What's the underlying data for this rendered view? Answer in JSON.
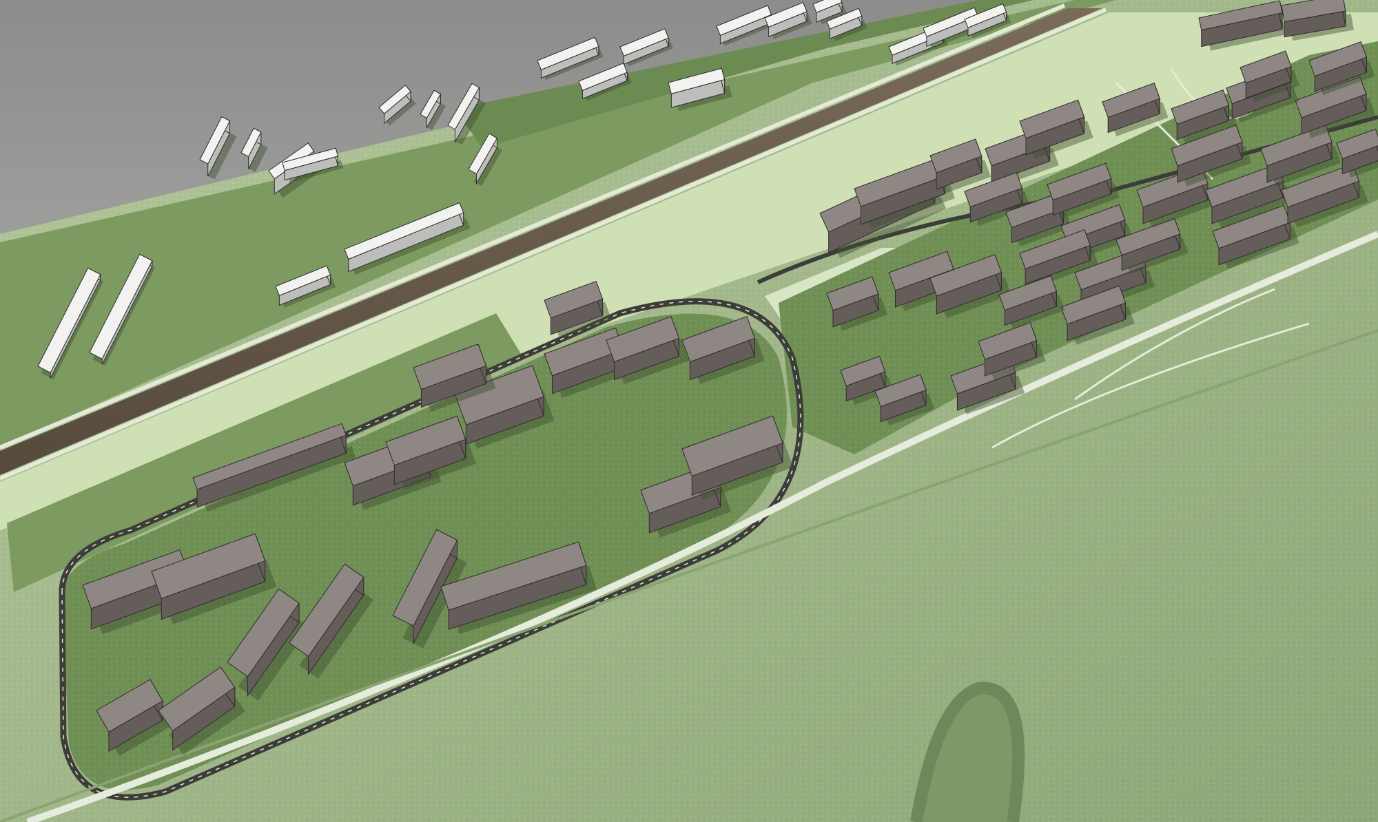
{
  "scene": {
    "kind": "aerial-3d-masterplan-render",
    "colors": {
      "sky_top": "#8f8f8d",
      "sky_bottom": "#c3c3c1",
      "valley_land": "#9fb487",
      "valley_land_dark": "#7f9868",
      "lawn": "#6f8f55",
      "lawn_light": "#cfe0b4",
      "path": "#e6ecdc",
      "road": "#3c3c38",
      "canal": "#6b5d4d",
      "building_roof": "#8f8784",
      "building_side": "#655d5a",
      "existing_roof": "#f2f2f0",
      "existing_side": "#bdbdbb",
      "shadow": "#3f4f30"
    },
    "layers": [
      "sky-backdrop",
      "valley-terrain",
      "existing-blocks-north",
      "canal",
      "west-campus-lawn",
      "central-plaza",
      "east-campus-lawn",
      "ring-road",
      "riverside-promenade",
      "proposed-buildings"
    ]
  }
}
